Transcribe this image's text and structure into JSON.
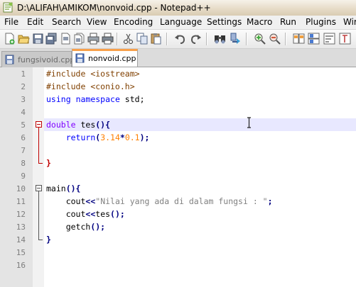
{
  "window": {
    "title": "D:\\ALIFAH\\AMIKOM\\nonvoid.cpp - Notepad++"
  },
  "menu": [
    "File",
    "Edit",
    "Search",
    "View",
    "Encoding",
    "Language",
    "Settings",
    "Macro",
    "Run",
    "Plugins",
    "Wir"
  ],
  "toolbar_icons": [
    "new-file-icon",
    "open-file-icon",
    "save-icon",
    "save-all-icon",
    "close-icon",
    "close-all-icon",
    "print-icon",
    "cut-icon",
    "copy-icon",
    "paste-icon",
    "undo-icon",
    "redo-icon",
    "find-icon",
    "replace-icon",
    "zoom-in-icon",
    "zoom-out-icon",
    "sync-v-icon",
    "sync-h-icon"
  ],
  "tabs": [
    {
      "label": "fungsivoid.cpp",
      "active": false
    },
    {
      "label": "nonvoid.cpp",
      "active": true
    }
  ],
  "line_numbers": [
    "1",
    "2",
    "3",
    "4",
    "5",
    "6",
    "7",
    "8",
    "9",
    "10",
    "11",
    "12",
    "13",
    "14",
    "15",
    "16"
  ],
  "code": {
    "l1": {
      "directive": "#include",
      "arg": " <iostream>"
    },
    "l2": {
      "directive": "#include",
      "arg": " <conio.h>"
    },
    "l3": {
      "k1": "using",
      "k2": "namespace",
      "rest": " std;"
    },
    "l5": {
      "type": "double",
      "name": " tes",
      "open": "(){"
    },
    "l6": {
      "indent": "    ",
      "kw": "return",
      "p1": "(",
      "n1": "3.14",
      "op": "*",
      "n2": "0.1",
      "p2": ");"
    },
    "l8": {
      "close": "}"
    },
    "l10": {
      "name": "main",
      "open": "(){"
    },
    "l11": {
      "indent": "    ",
      "obj": "cout",
      "op": "<<",
      "str": "\"Nilai yang ada di dalam fungsi : \"",
      "end": ";"
    },
    "l12": {
      "indent": "    ",
      "obj": "cout",
      "op": "<<",
      "call": "tes",
      "end": "();"
    },
    "l13": {
      "indent": "    ",
      "call": "getch",
      "end": "();"
    },
    "l14": {
      "close": "}"
    }
  },
  "colors": {
    "keyword": "#0000ff",
    "type": "#8000ff",
    "preprocessor": "#804000",
    "number": "#ff8000",
    "string": "#808080",
    "current_line": "#e8e8ff",
    "active_tab_accent": "#f8a04a"
  }
}
